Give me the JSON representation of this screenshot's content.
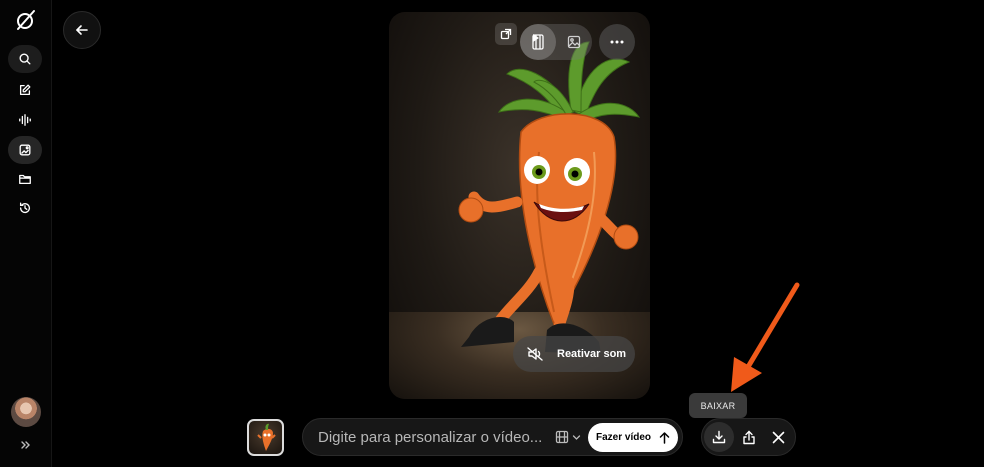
{
  "sidebar": {
    "logo_icon": "grok-logo-icon",
    "items": [
      {
        "name": "search",
        "icon": "search-icon"
      },
      {
        "name": "compose",
        "icon": "edit-icon"
      },
      {
        "name": "voice",
        "icon": "waveform-icon"
      },
      {
        "name": "imagine",
        "icon": "imagine-icon",
        "active": true
      },
      {
        "name": "projects",
        "icon": "folder-icon"
      },
      {
        "name": "history",
        "icon": "history-icon"
      }
    ],
    "expand_icon": "chevrons-right-icon"
  },
  "viewer": {
    "back_icon": "arrow-left-icon",
    "unmute_label": "Reativar som",
    "tooltip": "BAIXAR"
  },
  "composer": {
    "placeholder": "Digite para personalizar o vídeo...",
    "submit_label": "Fazer vídeo"
  },
  "colors": {
    "background": "#000000",
    "arrow": "#f05a1a",
    "submit_bg": "#ffffff"
  }
}
